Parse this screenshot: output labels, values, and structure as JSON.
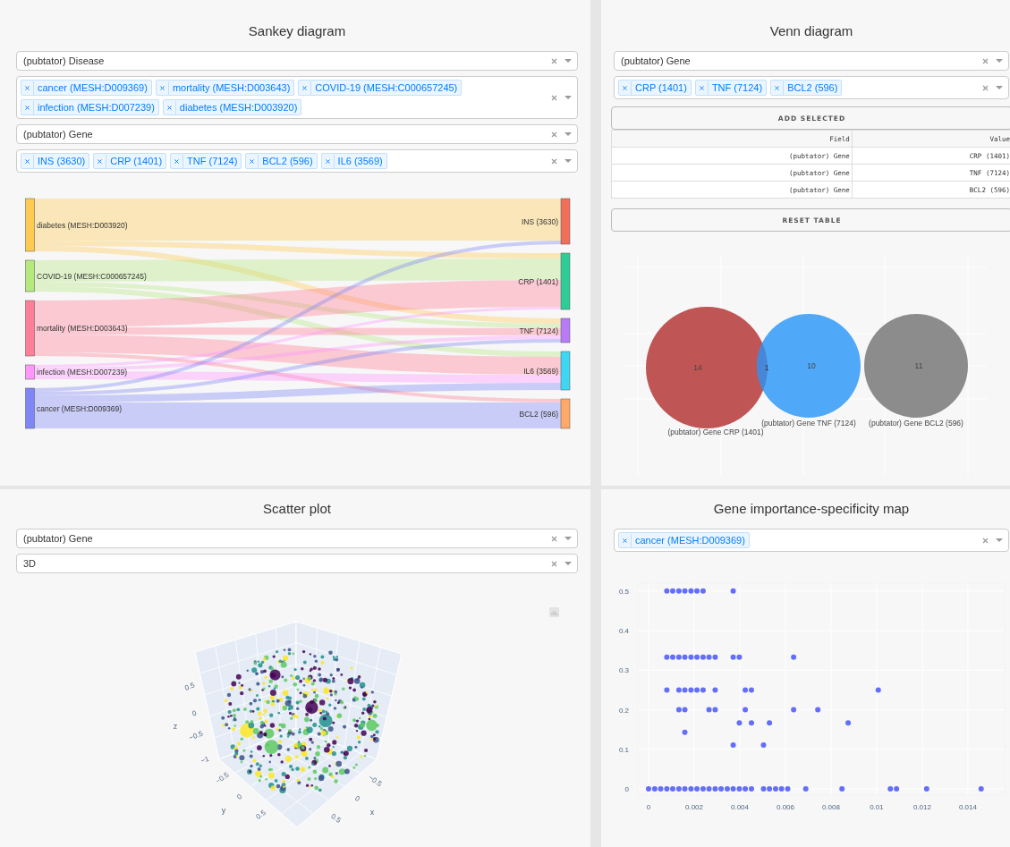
{
  "sankey": {
    "title": "Sankey diagram",
    "selects": [
      {
        "kind": "single",
        "value": "(pubtator) Disease"
      },
      {
        "kind": "multi",
        "chips": [
          "cancer (MESH:D009369)",
          "mortality (MESH:D003643)",
          "COVID-19 (MESH:C000657245)",
          "infection (MESH:D007239)",
          "diabetes (MESH:D003920)"
        ]
      },
      {
        "kind": "single",
        "value": "(pubtator) Gene"
      },
      {
        "kind": "multi",
        "chips": [
          "INS (3630)",
          "CRP (1401)",
          "TNF (7124)",
          "BCL2 (596)",
          "IL6 (3569)"
        ]
      }
    ],
    "nodes_left": [
      {
        "label": "diabetes (MESH:D003920)",
        "color": "#fecb52"
      },
      {
        "label": "COVID-19 (MESH:C000657245)",
        "color": "#b6e880"
      },
      {
        "label": "mortality (MESH:D003643)",
        "color": "#ff7f96"
      },
      {
        "label": "infection (MESH:D007239)",
        "color": "#ff97ff"
      },
      {
        "label": "cancer (MESH:D009369)",
        "color": "#7f86f5"
      }
    ],
    "nodes_right": [
      {
        "label": "INS (3630)",
        "color": "#ef6f5b"
      },
      {
        "label": "CRP (1401)",
        "color": "#2ecc96"
      },
      {
        "label": "TNF (7124)",
        "color": "#b77cf5"
      },
      {
        "label": "IL6 (3569)",
        "color": "#3ed6f0"
      },
      {
        "label": "BCL2 (596)",
        "color": "#ffa968"
      }
    ]
  },
  "venn": {
    "title": "Venn diagram",
    "selects": [
      {
        "kind": "single",
        "value": "(pubtator) Gene"
      },
      {
        "kind": "multi",
        "chips": [
          "CRP (1401)",
          "TNF (7124)",
          "BCL2 (596)"
        ]
      }
    ],
    "add_button": "ADD SELECTED",
    "table": {
      "columns": [
        "Field",
        "Value"
      ],
      "rows": [
        [
          "(pubtator) Gene",
          "CRP (1401)"
        ],
        [
          "(pubtator) Gene",
          "TNF (7124)"
        ],
        [
          "(pubtator) Gene",
          "BCL2 (596)"
        ]
      ]
    },
    "reset_button": "RESET TABLE",
    "sets": [
      {
        "count": "14",
        "label": "(pubtator) Gene CRP (1401)",
        "color": "#c05555"
      },
      {
        "count": "10",
        "label": "(pubtator) Gene TNF (7124)",
        "color": "#50a8f8"
      },
      {
        "count": "11",
        "label": "(pubtator) Gene BCL2 (596)",
        "color": "#8c8c8c"
      }
    ],
    "overlap": {
      "count": "1"
    }
  },
  "scatter": {
    "title": "Scatter plot",
    "selects": [
      {
        "kind": "single",
        "value": "(pubtator) Gene"
      },
      {
        "kind": "single",
        "value": "3D"
      }
    ],
    "axes": [
      {
        "title": "z",
        "ticks": [
          "0.5",
          "0",
          "−0.5",
          "−1"
        ]
      },
      {
        "title": "y",
        "ticks": [
          "−0.5",
          "0",
          "0.5"
        ]
      },
      {
        "title": "x",
        "ticks": [
          "−0.5",
          "0",
          "0.5"
        ]
      }
    ]
  },
  "importance": {
    "title": "Gene importance-specificity map",
    "selects": [
      {
        "kind": "multi",
        "chips": [
          "cancer (MESH:D009369)"
        ]
      }
    ],
    "chart_data": {
      "type": "scatter",
      "color": "#636efa",
      "x": [
        0.0008,
        0.00106,
        0.00133,
        0.00159,
        0.00186,
        0.00212,
        0.00239,
        0.00371,
        0.0008,
        0.00106,
        0.00133,
        0.00159,
        0.00186,
        0.00212,
        0.00239,
        0.00265,
        0.00292,
        0.00371,
        0.00398,
        0.00636,
        0.0008,
        0.00133,
        0.00159,
        0.00186,
        0.00212,
        0.00239,
        0.00292,
        0.00424,
        0.00451,
        0.01007,
        0.00133,
        0.00159,
        0.00265,
        0.00292,
        0.00424,
        0.00636,
        0.00742,
        0.00398,
        0.00451,
        0.0053,
        0.00875,
        0.00159,
        0.00371,
        0.00504,
        0,
        0.00027,
        0.00053,
        0.0008,
        0.00106,
        0.00133,
        0.00159,
        0.00186,
        0.00212,
        0.00239,
        0.00265,
        0.00292,
        0.00318,
        0.00345,
        0.00371,
        0.00398,
        0.00424,
        0.00451,
        0.00504,
        0.0053,
        0.00557,
        0.00583,
        0.0061,
        0.00689,
        0.00848,
        0.0106,
        0.01087,
        0.01219,
        0.01458
      ],
      "values": [
        0.5,
        0.5,
        0.5,
        0.5,
        0.5,
        0.5,
        0.5,
        0.5,
        0.333,
        0.333,
        0.333,
        0.333,
        0.333,
        0.333,
        0.333,
        0.333,
        0.333,
        0.333,
        0.333,
        0.333,
        0.25,
        0.25,
        0.25,
        0.25,
        0.25,
        0.25,
        0.25,
        0.25,
        0.25,
        0.25,
        0.2,
        0.2,
        0.2,
        0.2,
        0.2,
        0.2,
        0.2,
        0.167,
        0.167,
        0.167,
        0.167,
        0.143,
        0.111,
        0.111,
        0,
        0,
        0,
        0,
        0,
        0,
        0,
        0,
        0,
        0,
        0,
        0,
        0,
        0,
        0,
        0,
        0,
        0,
        0,
        0,
        0,
        0,
        0,
        0,
        0,
        0,
        0,
        0,
        0
      ],
      "xlim": [
        -0.00047,
        0.01561
      ],
      "ylim": [
        -0.0158,
        0.52
      ],
      "grid": true,
      "xticks": [
        0,
        0.002,
        0.004,
        0.006,
        0.008,
        0.01,
        0.012,
        0.014
      ],
      "yticks": [
        0,
        0.1,
        0.2,
        0.3,
        0.4,
        0.5
      ]
    }
  }
}
